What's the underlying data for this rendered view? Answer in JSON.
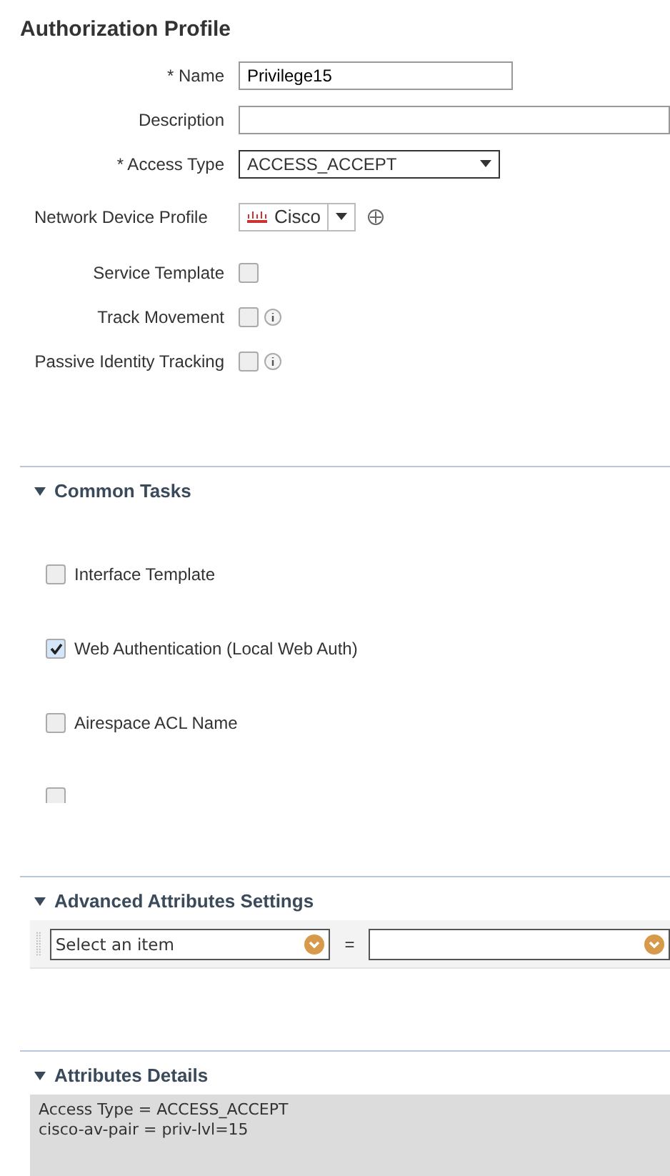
{
  "title": "Authorization Profile",
  "fields": [
    {
      "kind": "text",
      "label": "* Name",
      "value": "Privilege15"
    },
    {
      "kind": "text",
      "label": "Description"
    },
    {
      "kind": "select",
      "label": "* Access Type",
      "value": "ACCESS_ACCEPT"
    }
  ],
  "device_profile": {
    "label": "Network Device Profile",
    "value": "Cisco"
  },
  "options": [
    {
      "label": "Service Template",
      "checked": false,
      "info": false
    },
    {
      "label": "Track Movement",
      "checked": false,
      "info": true
    },
    {
      "label": "Passive Identity Tracking",
      "checked": false,
      "info": true
    }
  ],
  "common_tasks": {
    "title": "Common Tasks",
    "expanded": true,
    "items": [
      {
        "label": "Interface Template",
        "checked": false
      },
      {
        "label": "Web Authentication (Local Web Auth)",
        "checked": true
      },
      {
        "label": "Airespace ACL Name",
        "checked": false
      },
      {
        "checked": false
      }
    ]
  },
  "advanced": {
    "title": "Advanced Attributes Settings",
    "expanded": true,
    "attribute": {
      "placeholder": "Select an item"
    },
    "operator": "="
  },
  "details": {
    "title": "Attributes Details",
    "expanded": true,
    "lines": [
      "Access Type = ACCESS_ACCEPT",
      "cisco-av-pair = priv-lvl=15"
    ]
  }
}
